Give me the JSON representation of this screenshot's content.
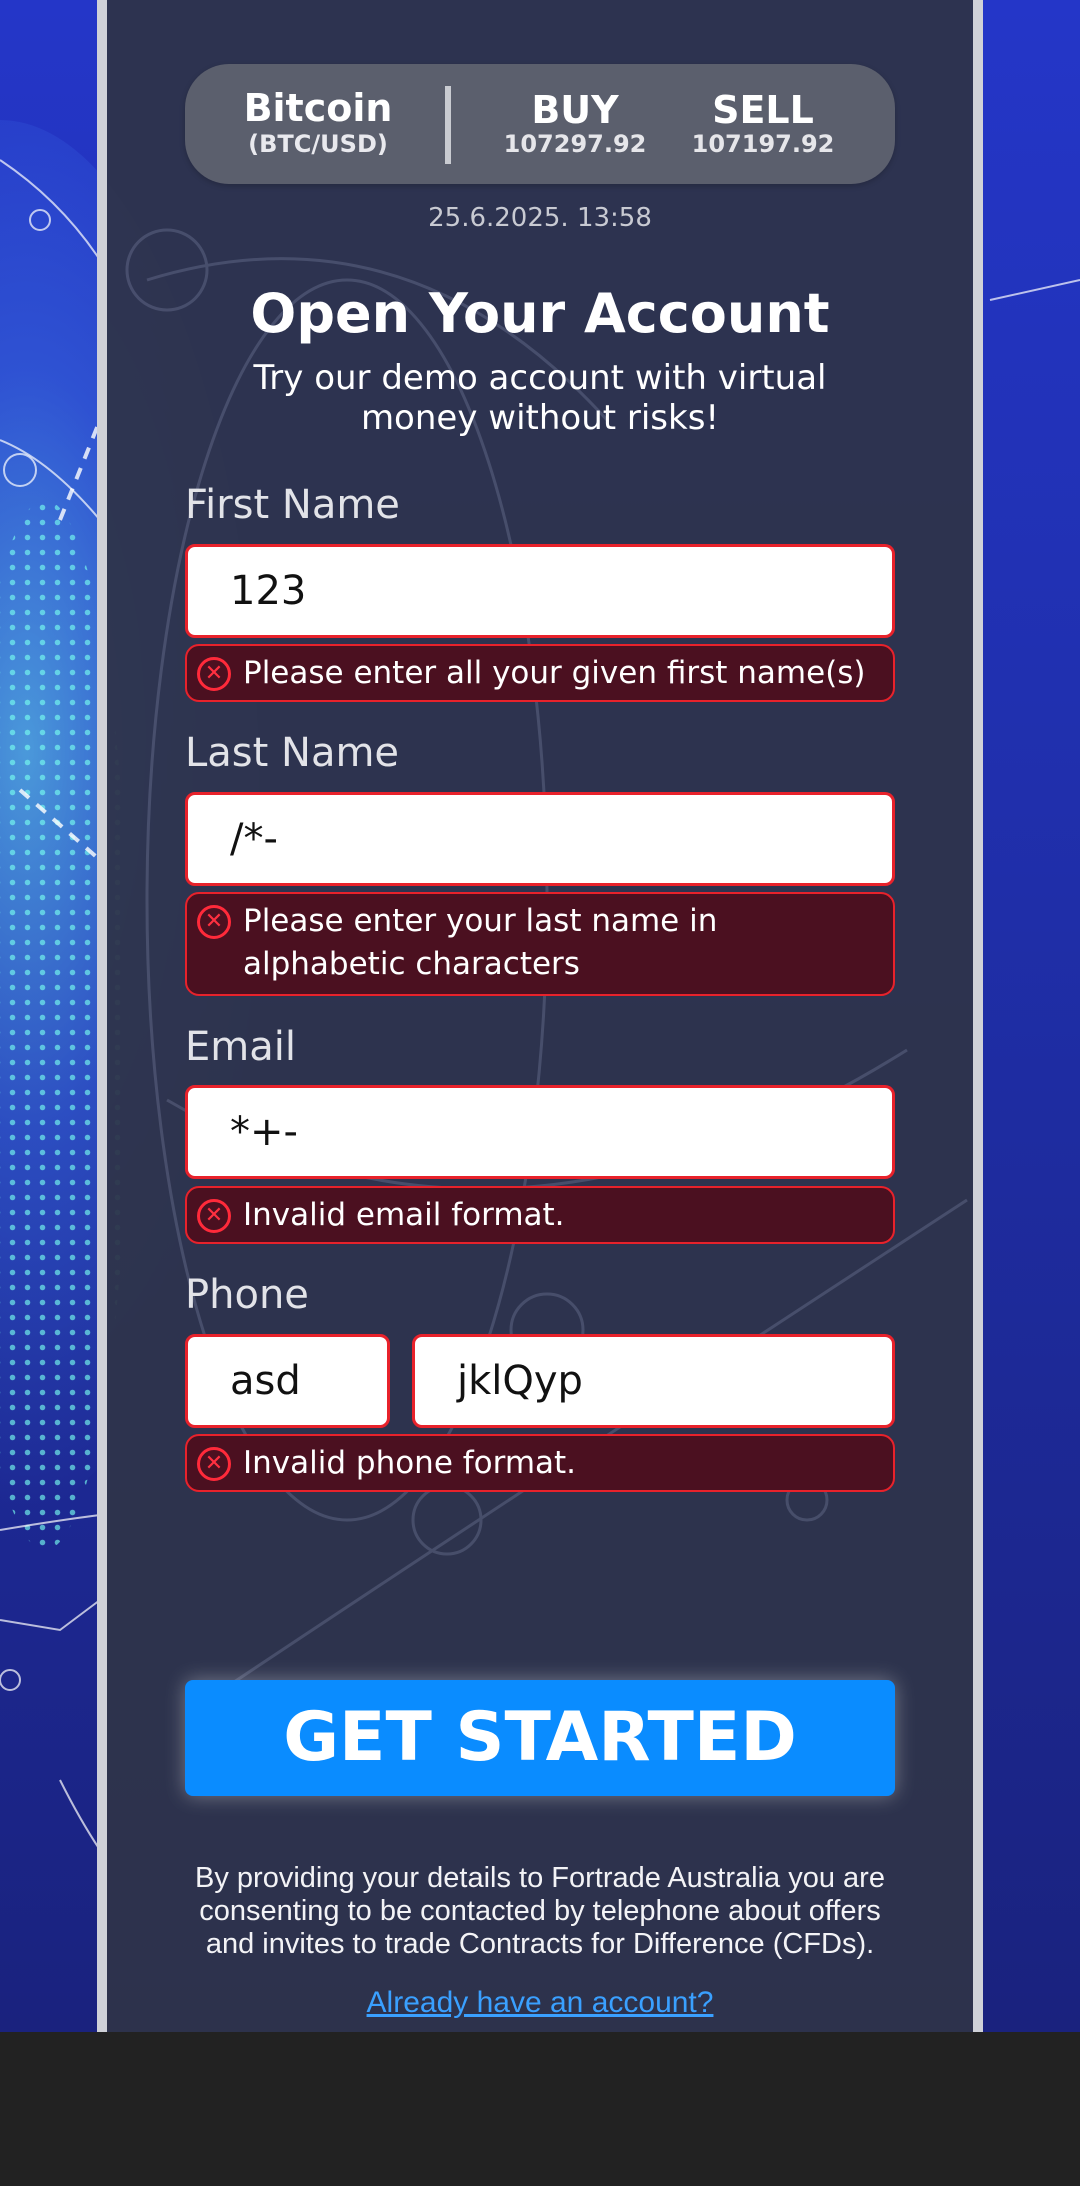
{
  "ticker": {
    "asset_name": "Bitcoin",
    "asset_pair": "(BTC/USD)",
    "buy_label": "BUY",
    "buy_value": "107297.92",
    "sell_label": "SELL",
    "sell_value": "107197.92"
  },
  "timestamp": "25.6.2025. 13:58",
  "form": {
    "title": "Open Your Account",
    "subtitle": "Try our demo account with virtual money without risks!",
    "first_name": {
      "label": "First Name",
      "value": "123",
      "error": "Please enter all your given first name(s)"
    },
    "last_name": {
      "label": "Last Name",
      "value": "/*-",
      "error": "Please enter your last name in alphabetic characters"
    },
    "email": {
      "label": "Email",
      "value": "*+-",
      "error": "Invalid email format."
    },
    "phone": {
      "label": "Phone",
      "code_value": "asd",
      "number_value": "jklQyp",
      "error": "Invalid phone format."
    },
    "submit_label": "GET STARTED",
    "disclaimer": "By providing your details to Fortrade Australia you are consenting to be contacted by telephone about offers and invites to trade Contracts for Difference (CFDs).",
    "login_link": "Already have an account?"
  },
  "colors": {
    "accent": "#0a8cff",
    "error_border": "#e8222b",
    "error_bg": "#4b1020",
    "panel": "#2e344a"
  },
  "icons": {
    "error": "error-circle-x-icon"
  }
}
